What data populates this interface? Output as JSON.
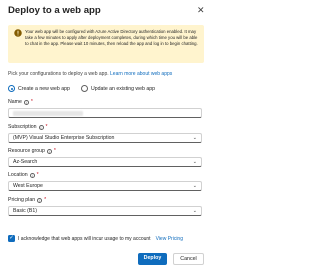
{
  "dialog": {
    "title": "Deploy to a web app",
    "close_glyph": "✕"
  },
  "banner": {
    "icon": "warning-icon",
    "text": "Your web app will be configured with Azure Active Directory authentication enabled. It may take a few minutes to apply after deployment completes, during which time you will be able to chat in the app. Please wait 10 minutes, then reload the app and log in to begin chatting."
  },
  "intro": {
    "text": "Pick your configurations to deploy a web app.",
    "link": "Learn more about web apps"
  },
  "mode": {
    "create_label": "Create a new web app",
    "update_label": "Update an existing web app",
    "selected": "create"
  },
  "fields": {
    "name_label": "Name",
    "subscription_label": "Subscription",
    "subscription_value": "(MVP) Visual Studio Enterprise Subscription",
    "resource_group_label": "Resource group",
    "resource_group_value": "Az-Search",
    "location_label": "Location",
    "location_value": "West Europe",
    "pricing_label": "Pricing plan",
    "pricing_value": "Basic (B1)"
  },
  "acknowledge": {
    "text": "I acknowledge that web apps will incur usage to my account",
    "link": "View Pricing",
    "checked": true
  },
  "buttons": {
    "deploy": "Deploy",
    "cancel": "Cancel"
  },
  "colors": {
    "accent": "#0f6cbd",
    "banner_bg": "#fff4ce",
    "required": "#c50f1f"
  }
}
